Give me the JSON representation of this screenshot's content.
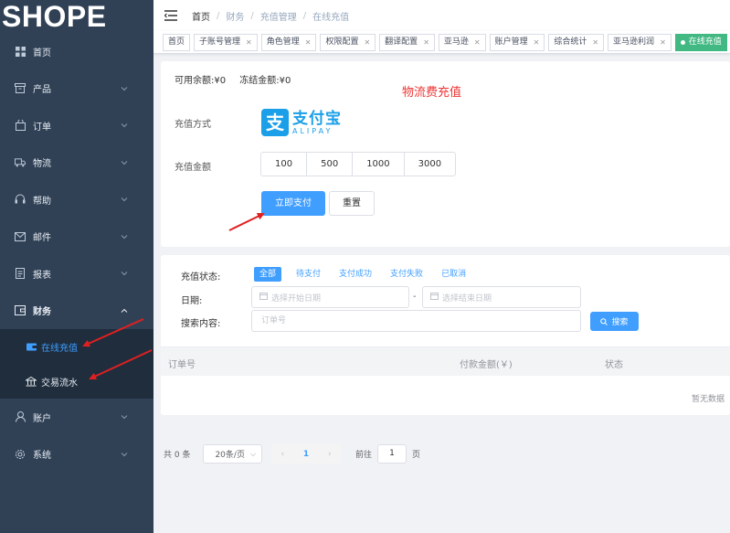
{
  "logo": "SHOPE",
  "sidebar": {
    "items": [
      {
        "label": "首页",
        "icon": "dashboard-icon"
      },
      {
        "label": "产品",
        "icon": "product-icon"
      },
      {
        "label": "订单",
        "icon": "order-icon"
      },
      {
        "label": "物流",
        "icon": "truck-icon"
      },
      {
        "label": "帮助",
        "icon": "headset-icon"
      },
      {
        "label": "邮件",
        "icon": "mail-icon"
      },
      {
        "label": "报表",
        "icon": "report-icon"
      },
      {
        "label": "财务",
        "icon": "finance-icon"
      }
    ],
    "finance_sub": [
      {
        "label": "在线充值",
        "icon": "wallet-icon",
        "active": true
      },
      {
        "label": "交易流水",
        "icon": "bank-icon",
        "active": false
      }
    ],
    "bottom_items": [
      {
        "label": "账户",
        "icon": "user-icon"
      },
      {
        "label": "系统",
        "icon": "settings-icon"
      }
    ]
  },
  "breadcrumb": [
    "首页",
    "财务",
    "充值管理",
    "在线充值"
  ],
  "tags": [
    "首页",
    "子账号管理",
    "角色管理",
    "权限配置",
    "翻译配置",
    "亚马逊",
    "账户管理",
    "综合统计",
    "亚马逊利润",
    "在线充值"
  ],
  "recharge": {
    "balance_label": "可用余额:",
    "balance_value": "¥0",
    "frozen_label": "冻结金额:",
    "frozen_value": "¥0",
    "title": "物流费充值",
    "method_label": "充值方式",
    "alipay_cn": "支付宝",
    "alipay_en": "ALIPAY",
    "alipay_glyph": "支",
    "amount_label": "充值金额",
    "amounts": [
      "100",
      "500",
      "1000",
      "3000"
    ],
    "pay_button": "立即支付",
    "reset_button": "重置"
  },
  "filter": {
    "status_label": "充值状态:",
    "status_options": [
      "全部",
      "待支付",
      "支付成功",
      "支付失败",
      "已取消"
    ],
    "date_label": "日期:",
    "start_placeholder": "选择开始日期",
    "end_placeholder": "选择结束日期",
    "date_separator": "-",
    "search_label": "搜索内容:",
    "search_placeholder": "订单号",
    "search_button": "搜索"
  },
  "table": {
    "columns": [
      "订单号",
      "付款金额(￥)",
      "状态"
    ],
    "empty_text": "暂无数据"
  },
  "pagination": {
    "total": "共 0 条",
    "page_size": "20条/页",
    "current_page": "1",
    "goto_label": "前往",
    "goto_value": "1",
    "goto_unit": "页"
  },
  "colors": {
    "sidebar_bg": "#304156",
    "primary": "#409eff",
    "active_tag": "#42b983",
    "title_red": "#e33333",
    "arrow_red": "#e02020"
  }
}
